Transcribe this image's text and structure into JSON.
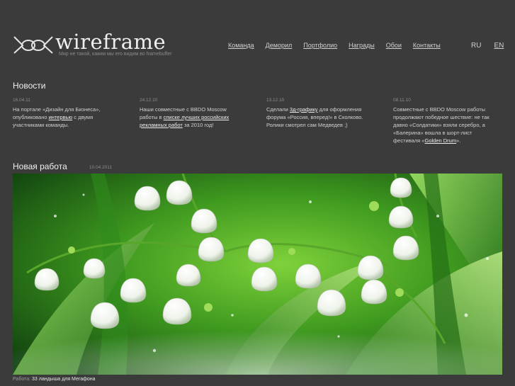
{
  "brand": {
    "name": "wireframe",
    "tagline": "Мир не такой, каким мы его видим во framebuffer"
  },
  "nav": {
    "items": [
      "Команда",
      "Деморил",
      "Портфолио",
      "Награды",
      "Обои",
      "Контакты"
    ]
  },
  "lang": {
    "ru": "RU",
    "en": "EN"
  },
  "news": {
    "title": "Новости",
    "items": [
      {
        "date": "16.04.11",
        "parts": [
          "На портале «Дизайн для Бизнеса», опубликовано ",
          "интервью",
          " с двумя участниками команды."
        ]
      },
      {
        "date": "24.12.10",
        "parts": [
          "Наши совместные с BBDO Moscow работы в ",
          "списке лучших российских рекламных работ",
          " за 2010 год!"
        ]
      },
      {
        "date": "13.12.10",
        "parts": [
          "Сделали ",
          "3д-графику",
          " для оформления форума «Россия, вперед!» в Сколково. Ролики смотрел сам Медведев ;)"
        ]
      },
      {
        "date": "08.11.10",
        "parts": [
          "Совместные с BBDO Moscow работы продолжают победное шествие: не так давно «Солдатики» взяли серебро, а «Балерина» вошла в шорт-лист фестиваля «",
          "Golden Drum",
          "»."
        ]
      }
    ]
  },
  "work": {
    "title": "Новая работа",
    "date": "10.04.2011",
    "caption_label": "Работа:",
    "caption_link": "33 ландыша для Мегафона"
  },
  "colors": {
    "background": "#3b3b3b",
    "text": "#d6d6d6",
    "green_dark": "#0f4a12",
    "green_light": "#8fdc3c"
  }
}
